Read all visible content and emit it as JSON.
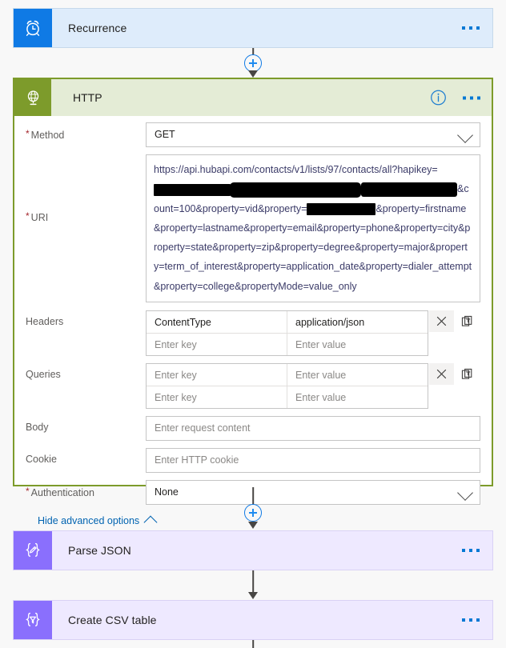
{
  "flow": {
    "steps": [
      {
        "name": "Recurrence",
        "icon": "alarm-clock-icon",
        "type": "trigger"
      },
      {
        "name": "HTTP",
        "icon": "globe-http-icon",
        "type": "action"
      },
      {
        "name": "Parse JSON",
        "icon": "braces-pencil-icon",
        "type": "action"
      },
      {
        "name": "Create CSV table",
        "icon": "braces-funnel-icon",
        "type": "action"
      }
    ]
  },
  "recurrence_card": {
    "title": "Recurrence",
    "menu_label": "..."
  },
  "http_card": {
    "title": "HTTP",
    "info_label": "i",
    "menu_label": "...",
    "fields": {
      "method": {
        "label": "Method",
        "required": true,
        "value": "GET"
      },
      "uri": {
        "label": "URI",
        "required": true,
        "text_part_1": "https://api.hubapi.com/contacts/v1/lists/97/contacts/all?hapikey=",
        "text_part_2": "&count=100&property=vid&property=",
        "text_part_3": "&property=firstname&property=lastname&property=email&property=phone&property=city&property=state&property=zip&property=degree&property=major&property=term_of_interest&property=application_date&property=dialer_attempt&property=college&propertyMode=value_only",
        "redactions": 4
      },
      "headers": {
        "label": "Headers",
        "rows": [
          {
            "key": "ContentType",
            "value": "application/json",
            "key_is_placeholder": false,
            "value_is_placeholder": false
          },
          {
            "key": "Enter key",
            "value": "Enter value",
            "key_is_placeholder": true,
            "value_is_placeholder": true
          }
        ],
        "delete_label": "×",
        "text_mode_label": "T"
      },
      "queries": {
        "label": "Queries",
        "rows": [
          {
            "key": "Enter key",
            "value": "Enter value",
            "key_is_placeholder": true,
            "value_is_placeholder": true
          },
          {
            "key": "Enter key",
            "value": "Enter value",
            "key_is_placeholder": true,
            "value_is_placeholder": true
          }
        ],
        "delete_label": "×",
        "text_mode_label": "T"
      },
      "body": {
        "label": "Body",
        "placeholder": "Enter request content",
        "value": ""
      },
      "cookie": {
        "label": "Cookie",
        "placeholder": "Enter HTTP cookie",
        "value": ""
      },
      "authentication": {
        "label": "Authentication",
        "required": true,
        "value": "None"
      }
    },
    "advanced_options_link": "Hide advanced options"
  },
  "parse_json_card": {
    "title": "Parse JSON",
    "menu_label": "..."
  },
  "create_csv_card": {
    "title": "Create CSV table",
    "menu_label": "..."
  },
  "colors": {
    "trigger_tile": "#0f7ae5",
    "trigger_bg": "#deecfb",
    "http_tile": "#7d9b2b",
    "http_header_bg": "#e4ecd6",
    "http_border": "#7d9b2b",
    "action_tile": "#8a6ffd",
    "action_bg": "#eee9ff",
    "link": "#0063b1",
    "required_asterisk": "#a4262c",
    "canvas_bg": "#f8f8f8"
  }
}
